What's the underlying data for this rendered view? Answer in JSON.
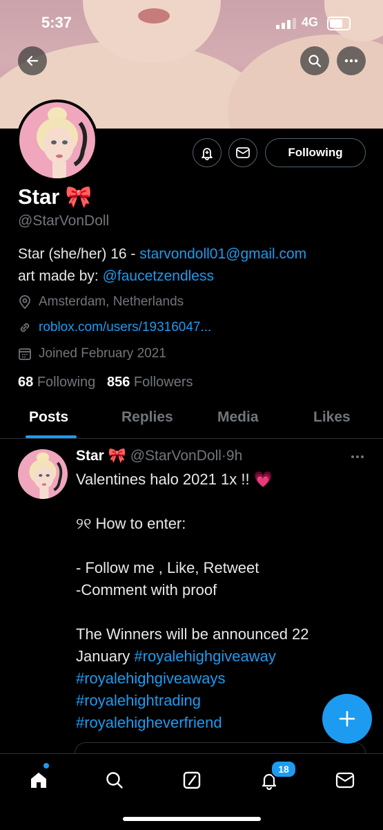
{
  "status_bar": {
    "time": "5:37",
    "network": "4G"
  },
  "profile": {
    "name": "Star 🎀",
    "handle": "@StarVonDoll",
    "bio_line1_text": "Star (she/her) 16 - ",
    "bio_line1_link": "starvondoll01@gmail.com",
    "bio_line2_text": "art made by: ",
    "bio_line2_link": "@faucetzendless",
    "location": "Amsterdam, Netherlands",
    "website": "roblox.com/users/19316047...",
    "joined": "Joined February 2021",
    "following_count": "68",
    "following_label": "Following",
    "followers_count": "856",
    "followers_label": "Followers",
    "follow_button": "Following"
  },
  "tabs": [
    "Posts",
    "Replies",
    "Media",
    "Likes"
  ],
  "post": {
    "name": "Star 🎀",
    "handle": "@StarVonDoll",
    "sep": "·",
    "time": "9h",
    "line1": "Valentines halo 2021 1x !! 💗",
    "line2": "୨୧ How to enter:",
    "line3": "- Follow me , Like, Retweet",
    "line4": "-Comment with proof",
    "line5": "The Winners will be announced 22",
    "line6_text": "January ",
    "tag1": "#royalehighgiveaway",
    "tag2": "#royalehighgiveaways",
    "tag3": "#royalehightrading",
    "tag4": "#royalehigheverfriend"
  },
  "notifications_badge": "18",
  "colors": {
    "accent": "#1d9bf0",
    "background": "#000000",
    "muted": "#71767b"
  }
}
